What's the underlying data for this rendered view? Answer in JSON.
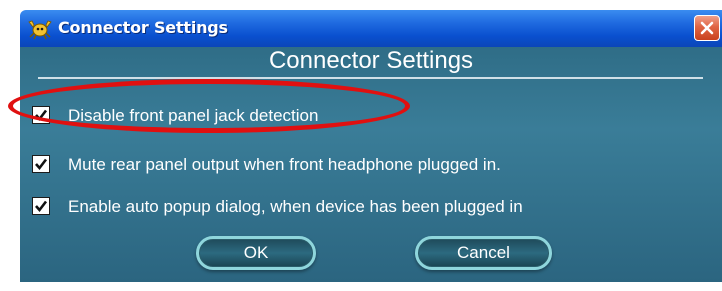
{
  "window": {
    "title": "Connector Settings",
    "icon": "realtek-crab-icon",
    "close_icon": "close-icon"
  },
  "dialog": {
    "heading": "Connector Settings",
    "options": [
      {
        "label": "Disable front panel jack detection",
        "checked": true
      },
      {
        "label": "Mute rear panel output when front headphone plugged in.",
        "checked": true
      },
      {
        "label": "Enable auto popup dialog, when device has been plugged in",
        "checked": true
      }
    ],
    "ok_label": "OK",
    "cancel_label": "Cancel"
  },
  "annotation": {
    "highlight_color": "#e01010"
  },
  "colors": {
    "titlebar": "#0a50cf",
    "panel": "#3a7d98",
    "button_border": "#8fd6dc"
  }
}
